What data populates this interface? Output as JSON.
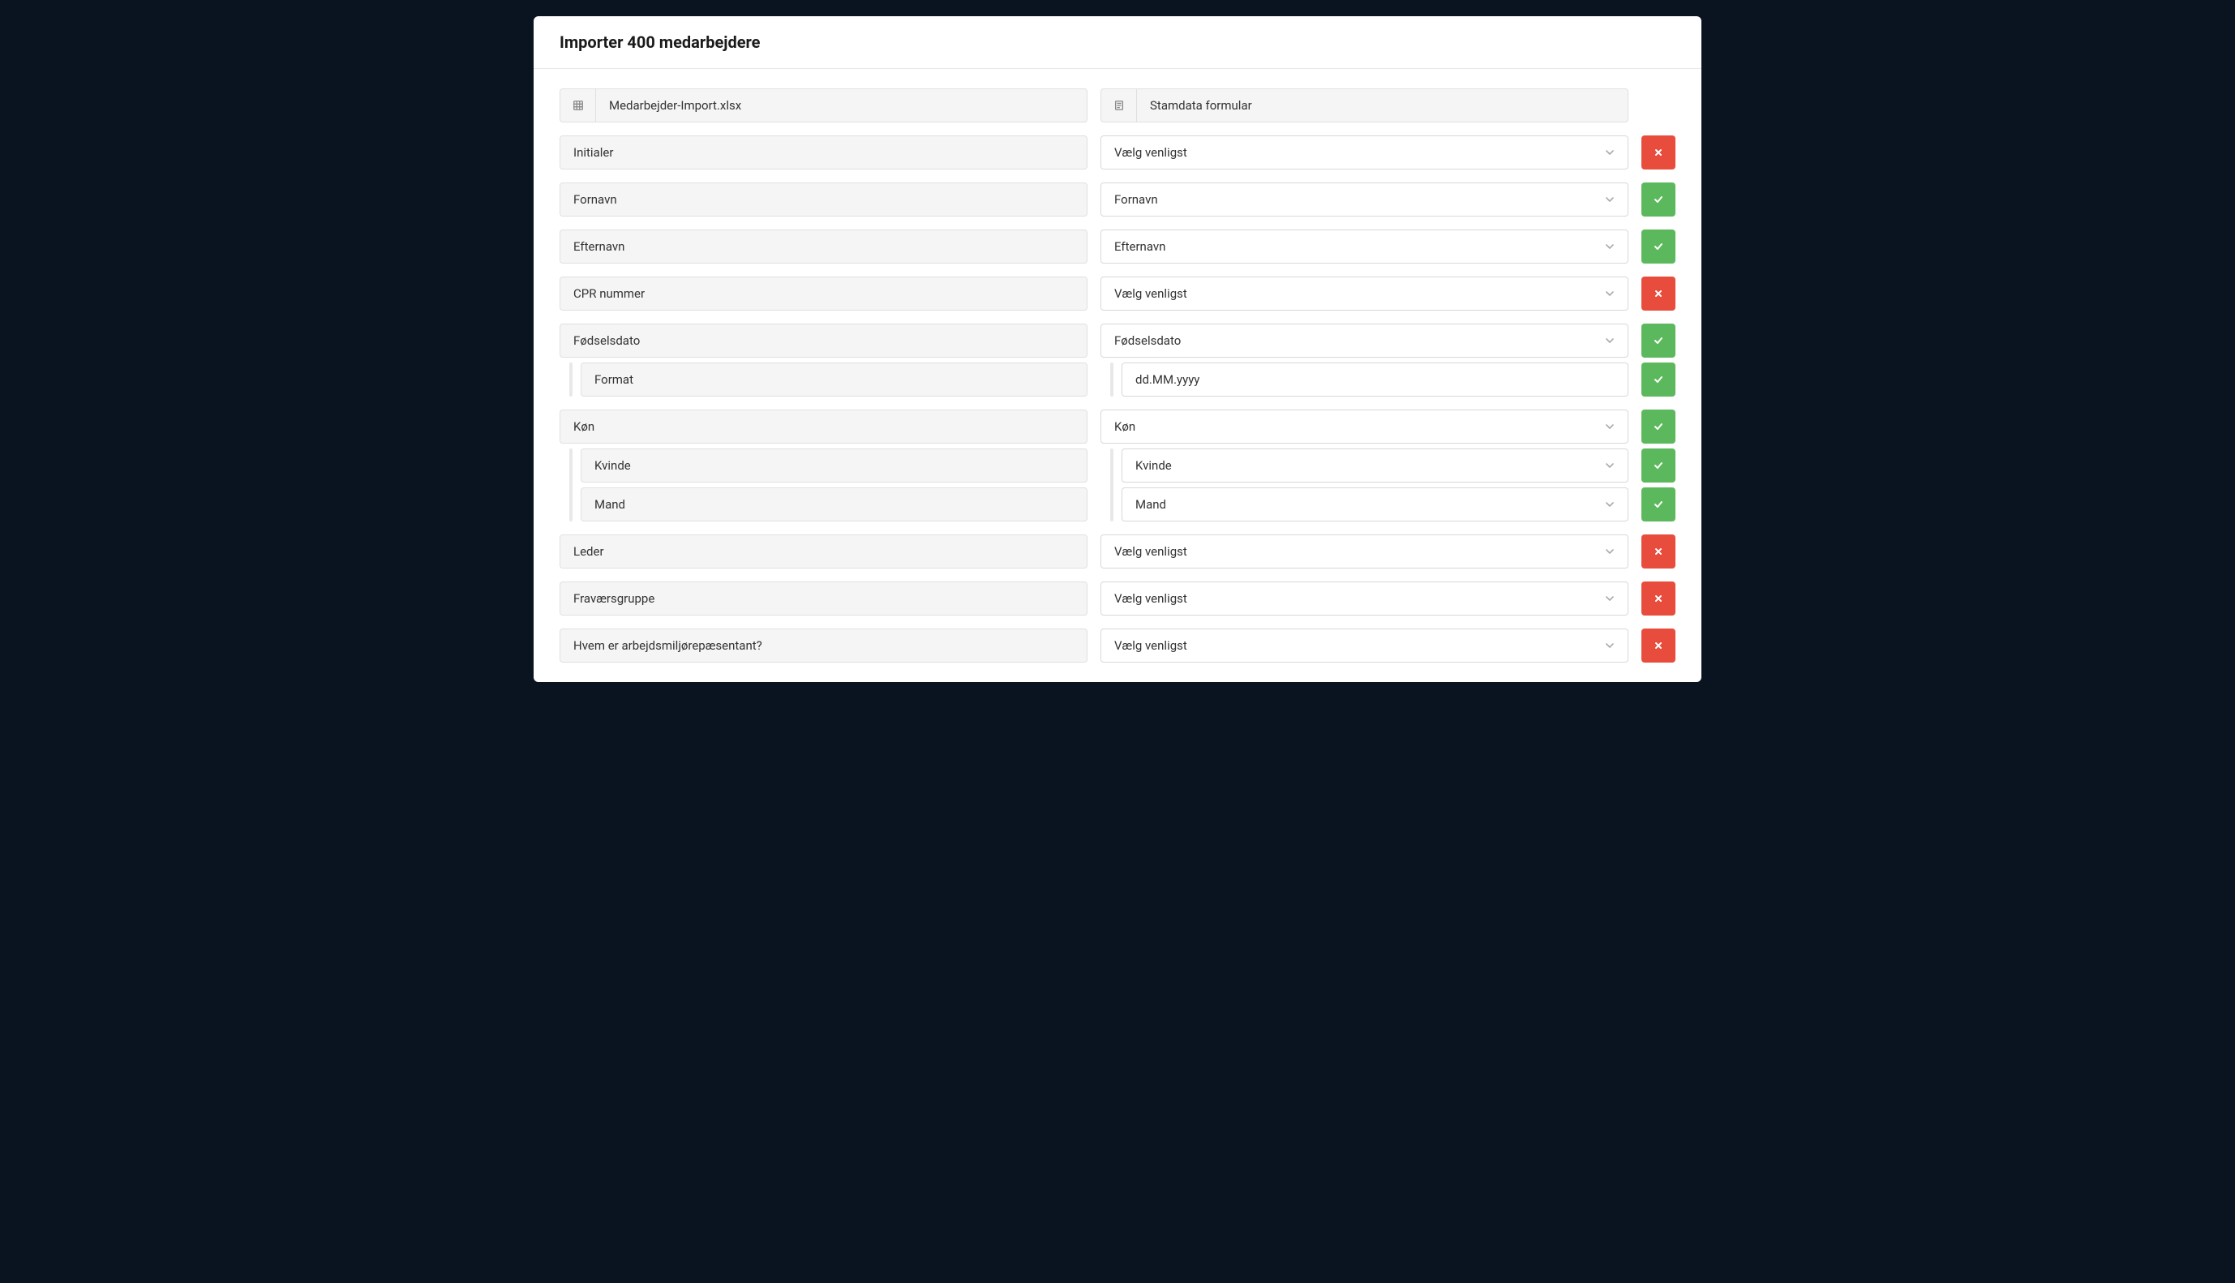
{
  "modal": {
    "title": "Importer 400 medarbejdere",
    "sourceFile": "Medarbejder-Import.xlsx",
    "targetForm": "Stamdata formular"
  },
  "placeholders": {
    "select": "Vælg venligst"
  },
  "rows": [
    {
      "source": "Initialer",
      "target": "Vælg venligst",
      "status": "error",
      "hasChevron": true,
      "subRows": []
    },
    {
      "source": "Fornavn",
      "target": "Fornavn",
      "status": "ok",
      "hasChevron": true,
      "subRows": []
    },
    {
      "source": "Efternavn",
      "target": "Efternavn",
      "status": "ok",
      "hasChevron": true,
      "subRows": []
    },
    {
      "source": "CPR nummer",
      "target": "Vælg venligst",
      "status": "error",
      "hasChevron": true,
      "subRows": []
    },
    {
      "source": "Fødselsdato",
      "target": "Fødselsdato",
      "status": "ok",
      "hasChevron": true,
      "subRows": [
        {
          "source": "Format",
          "target": "dd.MM.yyyy",
          "status": "ok",
          "hasChevron": false
        }
      ]
    },
    {
      "source": "Køn",
      "target": "Køn",
      "status": "ok",
      "hasChevron": true,
      "subRows": [
        {
          "source": "Kvinde",
          "target": "Kvinde",
          "status": "ok",
          "hasChevron": true
        },
        {
          "source": "Mand",
          "target": "Mand",
          "status": "ok",
          "hasChevron": true
        }
      ]
    },
    {
      "source": "Leder",
      "target": "Vælg venligst",
      "status": "error",
      "hasChevron": true,
      "subRows": []
    },
    {
      "source": "Fraværsgruppe",
      "target": "Vælg venligst",
      "status": "error",
      "hasChevron": true,
      "subRows": []
    },
    {
      "source": "Hvem er arbejdsmiljørepæsentant?",
      "target": "Vælg venligst",
      "status": "error",
      "hasChevron": true,
      "subRows": []
    }
  ]
}
